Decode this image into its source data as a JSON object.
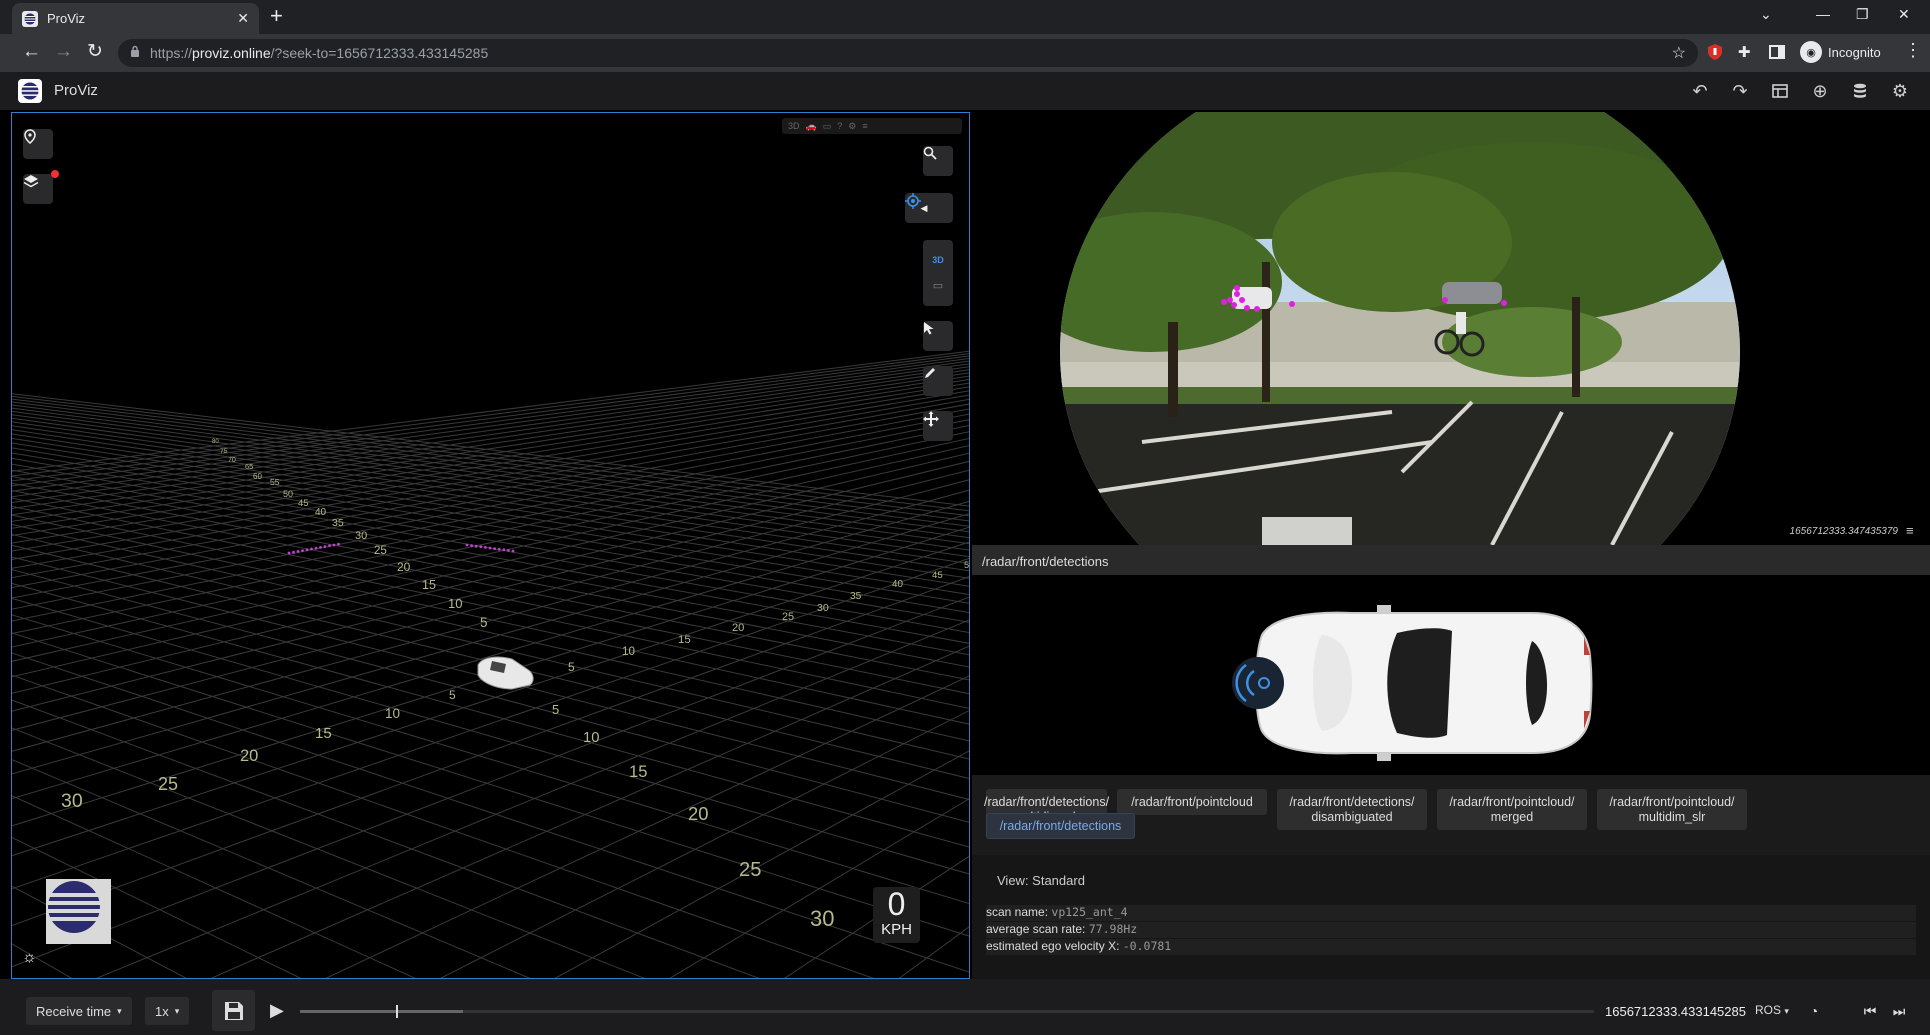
{
  "browser": {
    "tab_title": "ProViz",
    "tab_close": "✕",
    "new_tab": "+",
    "url_prefix": "https://",
    "url_host": "proviz.online",
    "url_path": "/?seek-to=1656712333.433145285",
    "incognito_label": "Incognito"
  },
  "app": {
    "title": "ProViz"
  },
  "viewer3d": {
    "mode_button": "3D",
    "speed_value": "0",
    "speed_unit": "KPH",
    "grid_labels_left": [
      "80",
      "75",
      "70",
      "65",
      "60",
      "55",
      "50",
      "45",
      "40",
      "35",
      "30",
      "25",
      "20",
      "15",
      "10",
      "5"
    ],
    "grid_labels_near": [
      "5",
      "10",
      "15",
      "20",
      "25",
      "30"
    ],
    "grid_labels_right": [
      "5",
      "10",
      "15",
      "20",
      "25",
      "30",
      "35",
      "40",
      "45",
      "5"
    ],
    "grid_labels_front": [
      "5",
      "10",
      "15",
      "20",
      "25",
      "30"
    ],
    "grid_labels_bottom": [
      "5",
      "10",
      "15",
      "20",
      "25",
      "30",
      "35"
    ],
    "point_color": "#c040d0"
  },
  "camera": {
    "timestamp": "1656712333.347435379",
    "detection_color": "#e020e0"
  },
  "detections_panel": {
    "header": "/radar/front/detections",
    "topics": [
      {
        "line1": "/radar/front/detections/",
        "line2": "multidim_slr"
      },
      {
        "line1": "/radar/front/pointcloud",
        "line2": ""
      },
      {
        "line1": "/radar/front/detections/",
        "line2": "disambiguated"
      },
      {
        "line1": "/radar/front/pointcloud/",
        "line2": "merged"
      },
      {
        "line1": "/radar/front/pointcloud/",
        "line2": "multidim_slr"
      }
    ],
    "active_topic": "/radar/front/detections",
    "view_label": "View: Standard",
    "info": [
      {
        "key": "scan name:",
        "value": "vp125_ant_4"
      },
      {
        "key": "average scan rate:",
        "value": "77.98Hz"
      },
      {
        "key": "estimated ego velocity X:",
        "value": "-0.0781"
      }
    ]
  },
  "playback": {
    "time_mode": "Receive time",
    "rate": "1x",
    "timestamp": "1656712333.433145285",
    "source": "ROS",
    "progress": 0.074
  }
}
